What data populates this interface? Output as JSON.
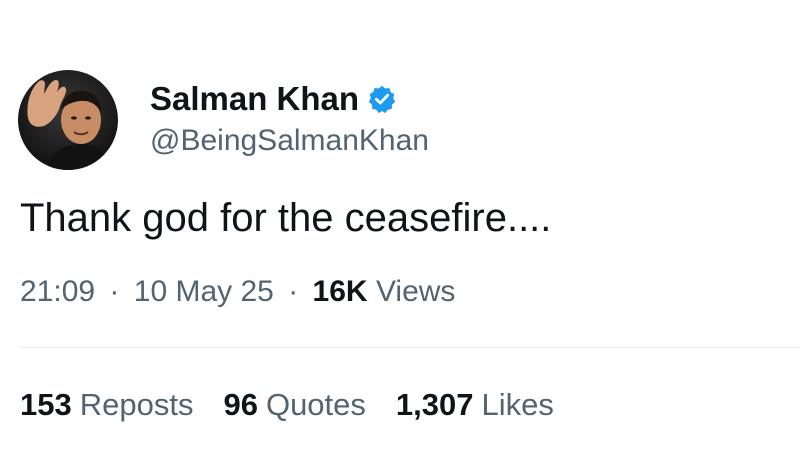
{
  "author": {
    "display_name": "Salman Khan",
    "handle": "@BeingSalmanKhan",
    "verified_color": "#1d9bf0"
  },
  "tweet": {
    "text": "Thank god for the ceasefire...."
  },
  "meta": {
    "time": "21:09",
    "separator": "·",
    "date": "10 May 25",
    "views_count": "16K",
    "views_label": "Views"
  },
  "stats": [
    {
      "count": "153",
      "label": "Reposts"
    },
    {
      "count": "96",
      "label": "Quotes"
    },
    {
      "count": "1,307",
      "label": "Likes"
    }
  ],
  "icons": {
    "verified": "verified-badge-icon",
    "avatar": "profile-photo"
  }
}
